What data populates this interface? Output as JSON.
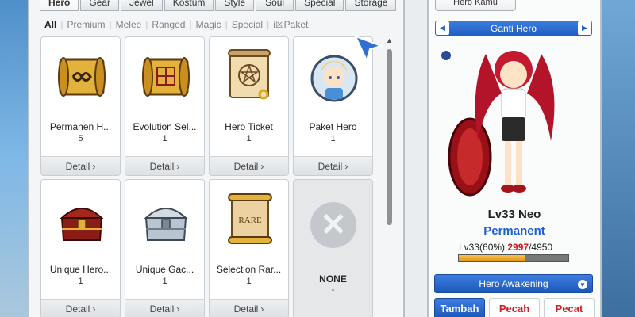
{
  "tabs": [
    "Hero",
    "Gear",
    "Jewel",
    "Kostum",
    "Style",
    "Soul",
    "Special",
    "Storage"
  ],
  "active_tab": "Hero",
  "filters": [
    "All",
    "Premium",
    "Melee",
    "Ranged",
    "Magic",
    "Special",
    "i☒Paket"
  ],
  "active_filter": "All",
  "items": [
    {
      "name": "Permanen H...",
      "count": "5",
      "detail": "Detail",
      "icon": "scroll-infinity-icon"
    },
    {
      "name": "Evolution Sel...",
      "count": "1",
      "detail": "Detail",
      "icon": "scroll-grid-icon"
    },
    {
      "name": "Hero Ticket",
      "count": "1",
      "detail": "Detail",
      "icon": "scroll-pentagram-icon"
    },
    {
      "name": "Paket Hero",
      "count": "1",
      "detail": "Detail",
      "icon": "hero-portrait-icon"
    },
    {
      "name": "Unique Hero...",
      "count": "1",
      "detail": "Detail",
      "icon": "red-chest-icon"
    },
    {
      "name": "Unique Gac...",
      "count": "1",
      "detail": "Detail",
      "icon": "silver-chest-icon"
    },
    {
      "name": "Selection Rar...",
      "count": "1",
      "detail": "Detail",
      "icon": "scroll-rare-icon"
    },
    {
      "name": "NONE",
      "count": "-",
      "detail": "",
      "icon": "empty-x-icon"
    }
  ],
  "right_panel": {
    "tab_label": "Hero Kamu",
    "switch_label": "Ganti Hero",
    "hero_level": "Lv33 Neo",
    "hero_type": "Permanent",
    "exp_prefix": "Lv33(60%)",
    "exp_current": "2997",
    "exp_total": "/4950",
    "exp_fraction": 0.605,
    "awaken_label": "Hero Awakening",
    "buttons": [
      "Tambah",
      "Pecah",
      "Pecat"
    ]
  },
  "colors": {
    "accent": "#1f5fc2",
    "danger": "#cc1f1f",
    "exp": "#f0b030"
  }
}
